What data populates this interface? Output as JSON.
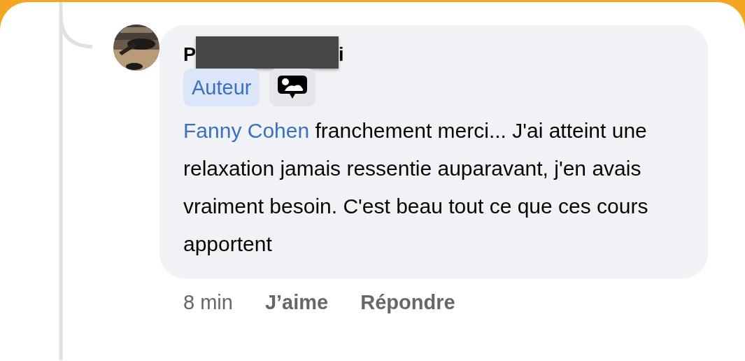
{
  "comment": {
    "author": {
      "name_start": "P",
      "name_end": "i",
      "redacted": true
    },
    "badges": [
      {
        "kind": "label",
        "text": "Auteur"
      },
      {
        "kind": "icon"
      }
    ],
    "mention": "Fanny Cohen",
    "text": "franchement merci... J'ai atteint une relaxation jamais ressentie auparavant, j'en avais vraiment besoin. C'est beau tout ce que ces cours apportent",
    "time": "8 min",
    "actions": [
      "J’aime",
      "Répondre"
    ]
  }
}
